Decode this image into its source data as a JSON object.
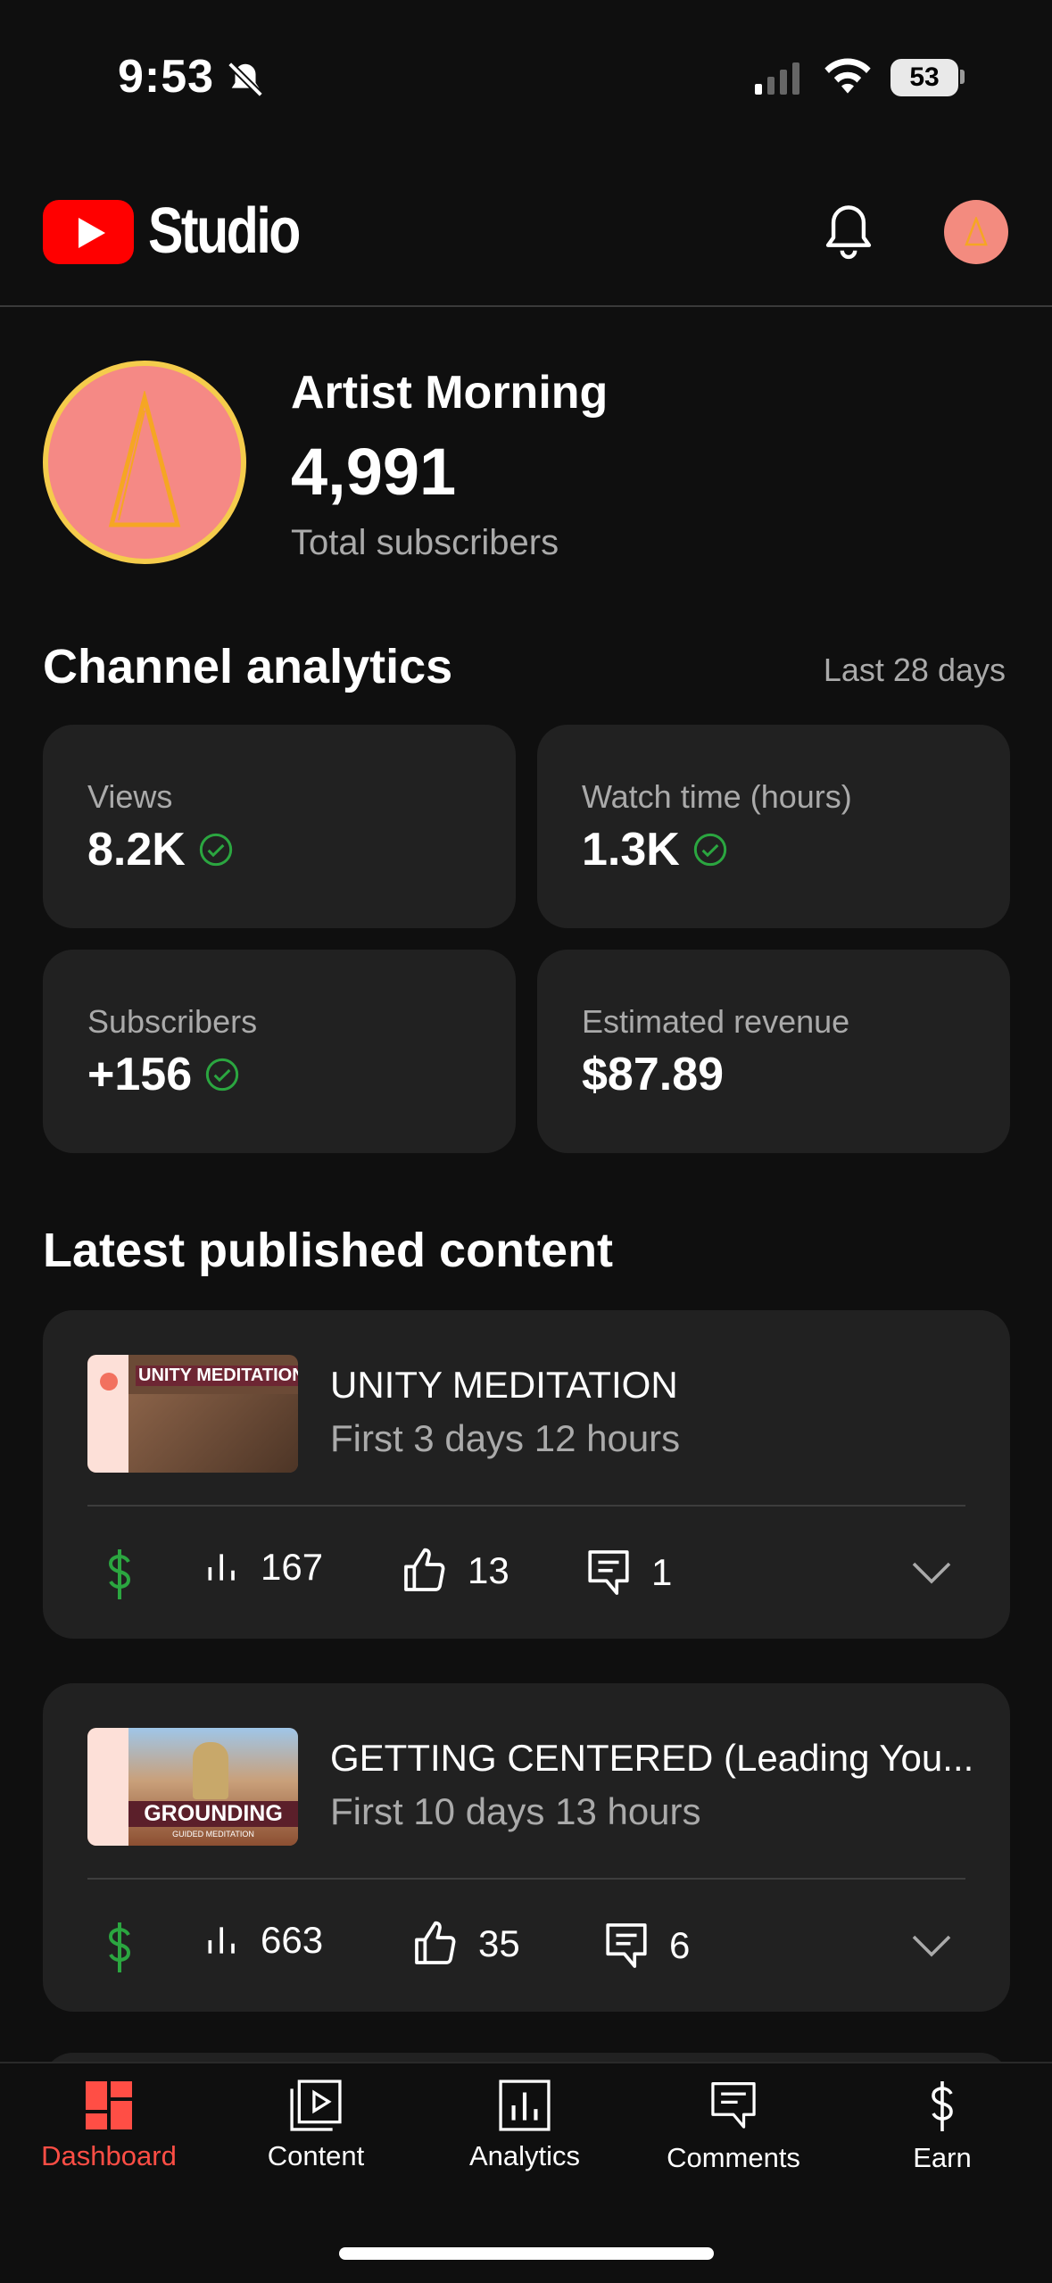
{
  "status_bar": {
    "time": "9:53",
    "battery": "53"
  },
  "header": {
    "studio": "Studio"
  },
  "channel": {
    "name": "Artist Morning",
    "subscribers": "4,991",
    "subscribers_label": "Total subscribers"
  },
  "analytics": {
    "title": "Channel analytics",
    "period": "Last 28 days",
    "metrics": [
      {
        "label": "Views",
        "value": "8.2K"
      },
      {
        "label": "Watch time (hours)",
        "value": "1.3K"
      },
      {
        "label": "Subscribers",
        "value": "+156"
      },
      {
        "label": "Estimated revenue",
        "value": "$87.89"
      }
    ]
  },
  "latest": {
    "title": "Latest published content",
    "videos": [
      {
        "title": "UNITY MEDITATION",
        "period": "First 3 days 12 hours",
        "thumb_text": "UNITY MEDITATION",
        "views": "167",
        "likes": "13",
        "comments": "1"
      },
      {
        "title": "GETTING CENTERED (Leading You...",
        "period": "First 10 days 13 hours",
        "thumb_text": "GROUNDING",
        "thumb_subtext": "GUIDED MEDITATION",
        "views": "663",
        "likes": "35",
        "comments": "6"
      }
    ]
  },
  "nav": [
    {
      "label": "Dashboard"
    },
    {
      "label": "Content"
    },
    {
      "label": "Analytics"
    },
    {
      "label": "Comments"
    },
    {
      "label": "Earn"
    }
  ],
  "colors": {
    "accent": "#ff4e45",
    "positive": "#2ba640",
    "card": "#212121",
    "background": "#0f0f0f"
  }
}
